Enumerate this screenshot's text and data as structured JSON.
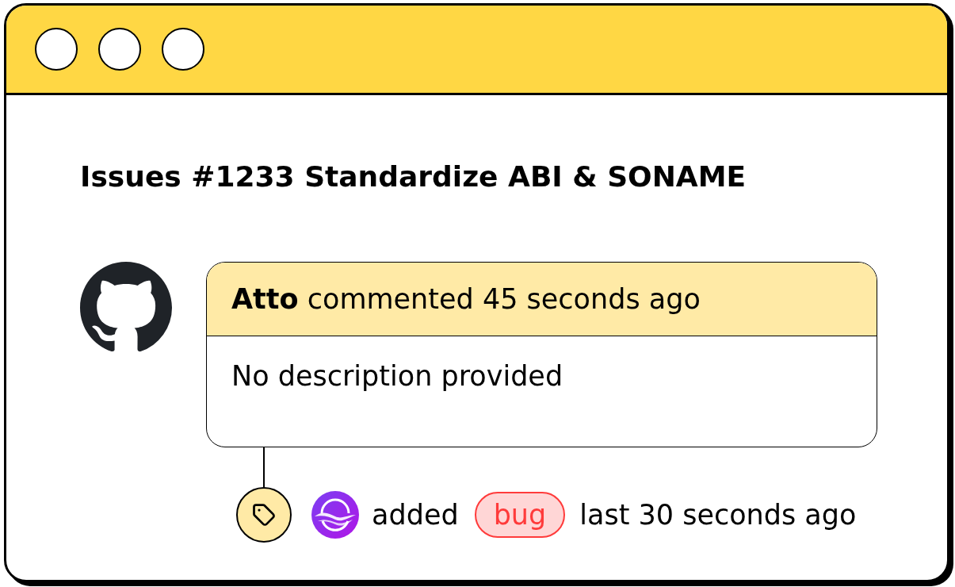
{
  "issue": {
    "heading": "Issues #1233 Standardize ABI & SONAME"
  },
  "comment": {
    "header": "**Atto** commented 45 seconds ago",
    "body": "No description provided"
  },
  "event": {
    "action": "added",
    "label": "bug",
    "time": "last 30 seconds ago"
  }
}
